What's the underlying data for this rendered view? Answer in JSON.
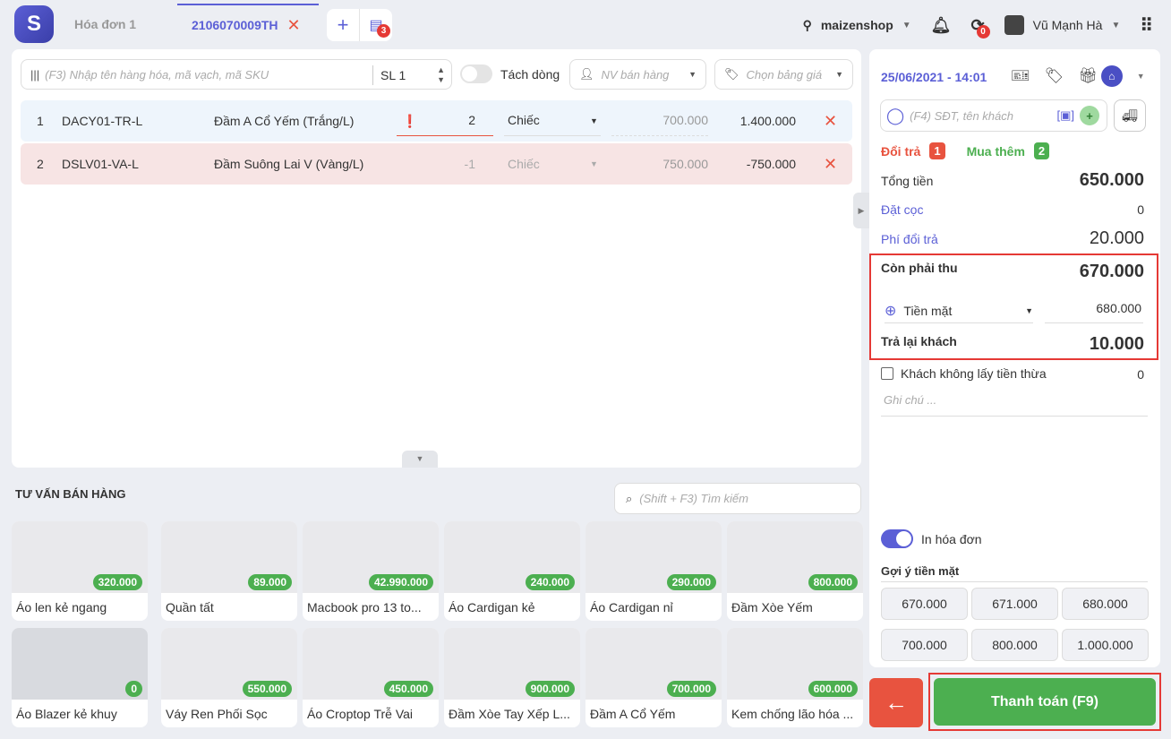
{
  "colors": {
    "accent": "#5b5fd6",
    "danger": "#e8533f",
    "success": "#4caf50"
  },
  "header": {
    "tabs": [
      {
        "label": "Hóa đơn 1"
      },
      {
        "label": "2106070009TH"
      }
    ],
    "add_icon": "+",
    "invoice_badge": "3",
    "store": "maizenshop",
    "sync_badge": "0",
    "user": "Vũ Mạnh Hà"
  },
  "toolbar": {
    "search_placeholder": "(F3) Nhập tên hàng hóa, mã vạch, mã SKU",
    "qty": "SL 1",
    "split_label": "Tách dòng",
    "staff_placeholder": "NV bán hàng",
    "pricebook_placeholder": "Chọn bảng giá"
  },
  "lines": [
    {
      "no": "1",
      "sku": "DACY01-TR-L",
      "name": "Đầm A Cổ Yếm (Trắng/L)",
      "qty": "2",
      "unit": "Chiếc",
      "price": "700.000",
      "total": "1.400.000"
    },
    {
      "no": "2",
      "sku": "DSLV01-VA-L",
      "name": "Đầm Suông Lai V (Vàng/L)",
      "qty": "-1",
      "unit": "Chiếc",
      "price": "750.000",
      "total": "-750.000"
    }
  ],
  "products": {
    "title": "TƯ VẤN BÁN HÀNG",
    "search_placeholder": "(Shift + F3) Tìm kiếm",
    "items": [
      {
        "name": "Áo len kẻ ngang",
        "price": "320.000"
      },
      {
        "name": "Quần tất",
        "price": "89.000"
      },
      {
        "name": "Macbook pro 13 to...",
        "price": "42.990.000"
      },
      {
        "name": "Áo Cardigan kẻ",
        "price": "240.000"
      },
      {
        "name": "Áo Cardigan nỉ",
        "price": "290.000"
      },
      {
        "name": "Đầm Xòe Yếm",
        "price": "800.000"
      },
      {
        "name": "Áo Blazer kẻ khuy",
        "price": "0"
      },
      {
        "name": "Váy Ren Phối Sọc",
        "price": "550.000"
      },
      {
        "name": "Áo Croptop Trễ Vai",
        "price": "450.000"
      },
      {
        "name": "Đầm Xòe Tay Xếp L...",
        "price": "900.000"
      },
      {
        "name": "Đầm A Cổ Yếm",
        "price": "700.000"
      },
      {
        "name": "Kem chống lão hóa ...",
        "price": "600.000"
      }
    ]
  },
  "checkout": {
    "datetime": "25/06/2021 - 14:01",
    "customer_placeholder": "(F4) SĐT, tên khách",
    "return_label": "Đổi trả",
    "return_count": "1",
    "buy_label": "Mua thêm",
    "buy_count": "2",
    "total_label": "Tổng tiền",
    "total": "650.000",
    "deposit_label": "Đặt cọc",
    "deposit": "0",
    "fee_label": "Phí đổi trả",
    "fee": "20.000",
    "due_label": "Còn phải thu",
    "due": "670.000",
    "method": "Tiền mặt",
    "paid": "680.000",
    "change_label": "Trả lại khách",
    "change": "10.000",
    "no_change_label": "Khách không lấy tiền thừa",
    "no_change_value": "0",
    "note_placeholder": "Ghi chú ...",
    "print_label": "In hóa đơn",
    "suggest_label": "Gợi ý tiền mặt",
    "suggestions": [
      "670.000",
      "671.000",
      "680.000",
      "700.000",
      "800.000",
      "1.000.000"
    ],
    "pay_label": "Thanh toán (F9)",
    "back_icon": "←"
  }
}
